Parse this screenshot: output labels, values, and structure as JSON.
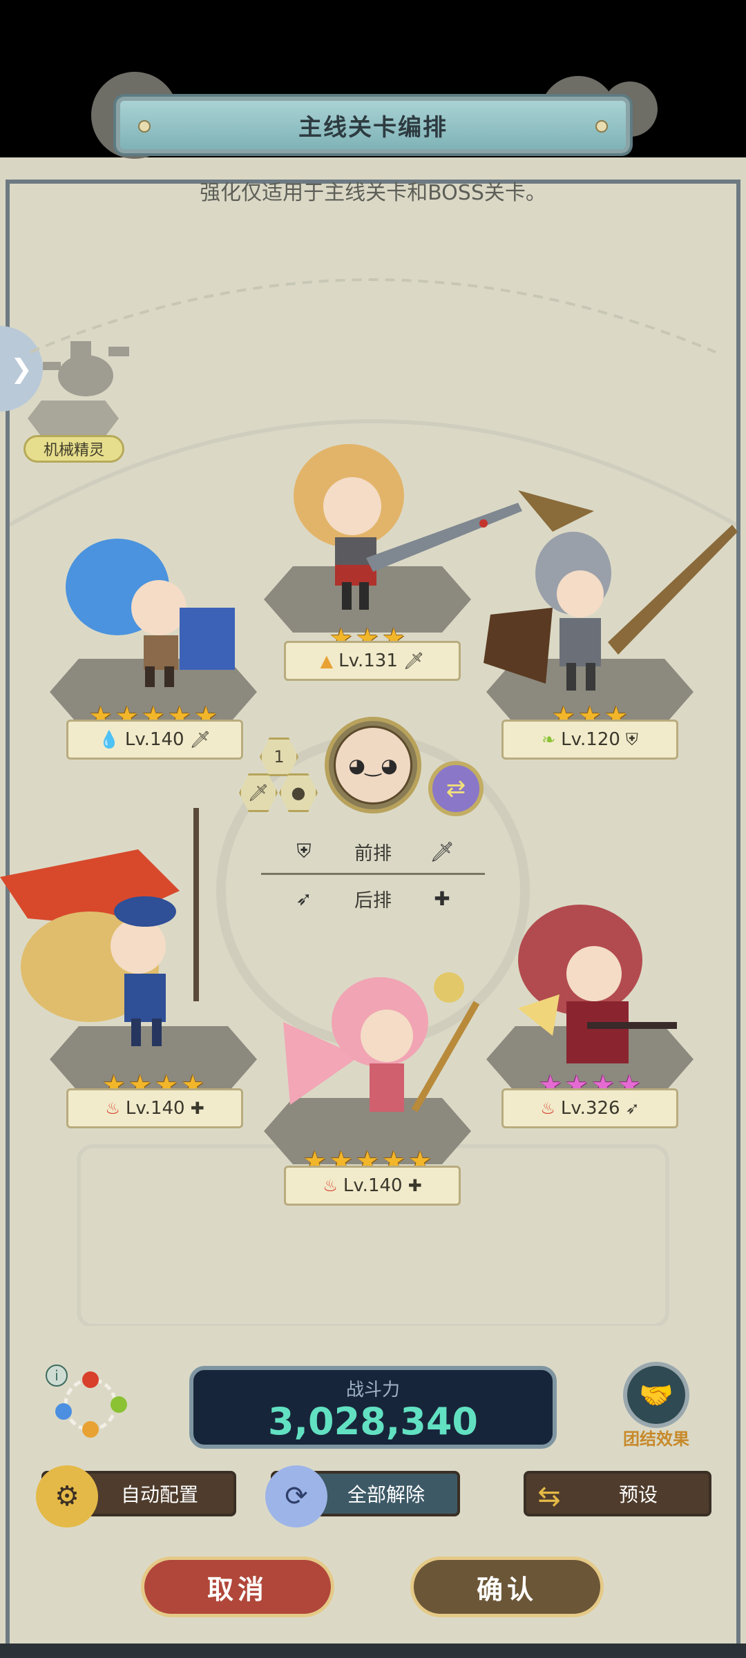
{
  "title": "主线关卡编排",
  "subtitle": "强化仅适用于主线关卡和BOSS关卡。",
  "side_tab_icon": "chevron-right-icon",
  "mech_sprite_label": "机械精灵",
  "heroes": [
    {
      "slot": "top-center",
      "stars": 3,
      "star_color": "gold",
      "element_icon": "earth-icon",
      "level": "Lv.131",
      "role_icon": "sword-icon"
    },
    {
      "slot": "upper-left",
      "stars": 5,
      "star_color": "gold",
      "element_icon": "water-icon",
      "level": "Lv.140",
      "role_icon": "sword-icon"
    },
    {
      "slot": "upper-right",
      "stars": 3,
      "star_color": "gold",
      "element_icon": "wind-icon",
      "level": "Lv.120",
      "role_icon": "shield-icon"
    },
    {
      "slot": "lower-left",
      "stars": 4,
      "star_color": "gold",
      "element_icon": "fire-icon",
      "level": "Lv.140",
      "role_icon": "plus-icon"
    },
    {
      "slot": "lower-right",
      "stars": 4,
      "star_color": "pink",
      "element_icon": "fire-icon",
      "level": "Lv.326",
      "role_icon": "bow-icon"
    },
    {
      "slot": "bottom-center",
      "stars": 5,
      "star_color": "gold",
      "element_icon": "fire-icon",
      "level": "Lv.140",
      "role_icon": "plus-icon"
    }
  ],
  "center": {
    "badge_number": "1",
    "front_row_label": "前排",
    "back_row_label": "后排"
  },
  "power": {
    "label": "战斗力",
    "value": "3,028,340"
  },
  "bond_label": "团结效果",
  "buttons": {
    "auto": "自动配置",
    "release_all": "全部解除",
    "preset": "预设",
    "cancel": "取消",
    "confirm": "确认"
  },
  "colors": {
    "power_value": "#62e1c2",
    "cancel_button": "#b0473a",
    "confirm_button": "#6b5637"
  }
}
